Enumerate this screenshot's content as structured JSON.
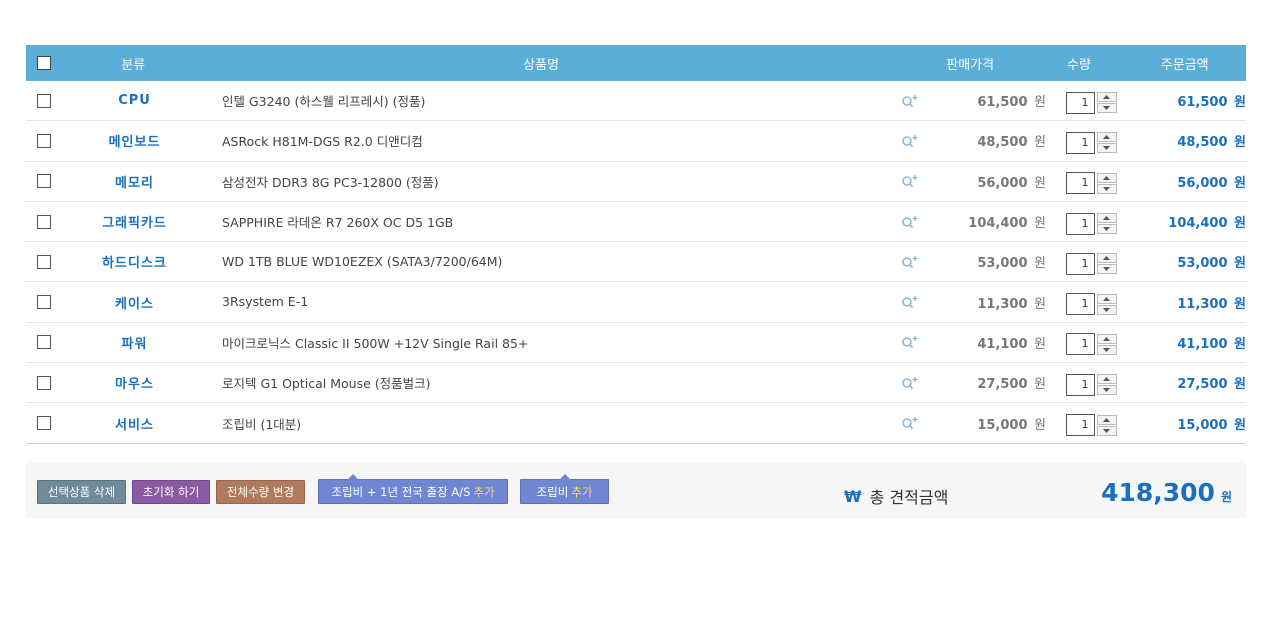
{
  "header": {
    "category": "분류",
    "name": "상품명",
    "price": "판매가격",
    "qty": "수량",
    "total": "주문금액"
  },
  "currency_unit": "원",
  "items": [
    {
      "category": "CPU",
      "name": "인텔 G3240 (하스웰 리프레시) (정품)",
      "price": "61,500",
      "qty": "1",
      "total": "61,500"
    },
    {
      "category": "메인보드",
      "name": "ASRock H81M-DGS R2.0 디앤디컴",
      "price": "48,500",
      "qty": "1",
      "total": "48,500"
    },
    {
      "category": "메모리",
      "name": "삼성전자 DDR3 8G PC3-12800 (정품)",
      "price": "56,000",
      "qty": "1",
      "total": "56,000"
    },
    {
      "category": "그래픽카드",
      "name": "SAPPHIRE 라데온 R7 260X OC D5 1GB",
      "price": "104,400",
      "qty": "1",
      "total": "104,400"
    },
    {
      "category": "하드디스크",
      "name": "WD 1TB BLUE WD10EZEX (SATA3/7200/64M)",
      "price": "53,000",
      "qty": "1",
      "total": "53,000"
    },
    {
      "category": "케이스",
      "name": "3Rsystem E-1",
      "price": "11,300",
      "qty": "1",
      "total": "11,300"
    },
    {
      "category": "파워",
      "name": "마이크로닉스 Classic II 500W +12V Single Rail 85+",
      "price": "41,100",
      "qty": "1",
      "total": "41,100"
    },
    {
      "category": "마우스",
      "name": "로지텍 G1 Optical Mouse (정품벌크)",
      "price": "27,500",
      "qty": "1",
      "total": "27,500"
    },
    {
      "category": "서비스",
      "name": "조립비 (1대분)",
      "price": "15,000",
      "qty": "1",
      "total": "15,000"
    }
  ],
  "icons": {
    "zoom": "zoom-plus-icon",
    "checkbox": "checkbox",
    "won_sign": "won-sign-icon"
  },
  "footer": {
    "delete_selected": "선택상품 삭제",
    "reset": "초기화 하기",
    "change_all_qty": "전체수량 변경",
    "add_assembly_as_prefix": "조립비 + 1년 전국 출장 A/S",
    "add_assembly_prefix": "조립비",
    "add_word": "추가",
    "won_symbol": "₩",
    "total_label": "총 견적금액",
    "total_value": "418,300",
    "total_unit": "원"
  },
  "colors": {
    "header_bg": "#5aaed8",
    "accent_blue": "#1b6fc0",
    "highlight_yellow": "#ffe338"
  }
}
